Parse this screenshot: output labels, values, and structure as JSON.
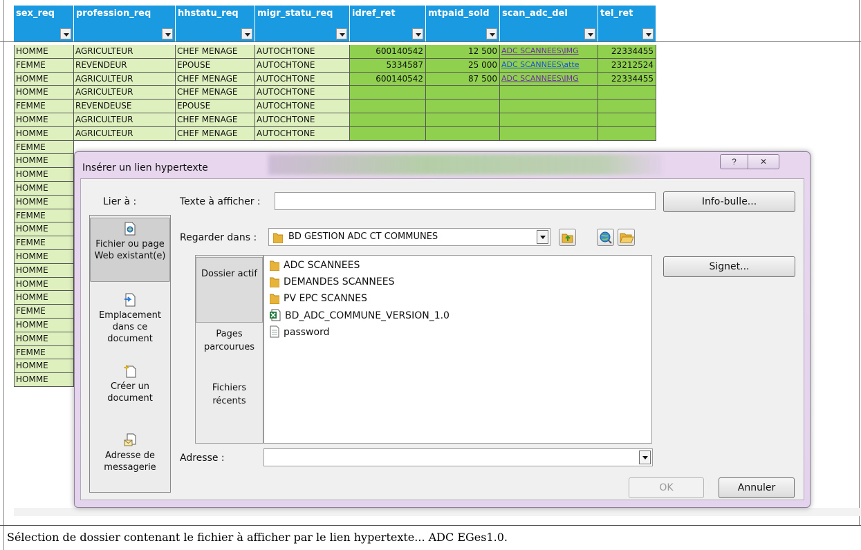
{
  "spreadsheet": {
    "headers": [
      "sex_req",
      "profession_req",
      "hhstatu_req",
      "migr_statu_req",
      "idref_ret",
      "mtpaid_sold",
      "scan_adc_del",
      "tel_ret"
    ],
    "rows": [
      [
        "HOMME",
        "AGRICULTEUR",
        "CHEF MENAGE",
        "AUTOCHTONE",
        "600140542",
        "12 500",
        "ADC SCANNEES\\IMG",
        "22334455"
      ],
      [
        "FEMME",
        "REVENDEUR",
        "EPOUSE",
        "AUTOCHTONE",
        "5334587",
        "25 000",
        "ADC SCANNEES\\atte",
        "23212524"
      ],
      [
        "HOMME",
        "AGRICULTEUR",
        "CHEF MENAGE",
        "AUTOCHTONE",
        "600140542",
        "87 500",
        "ADC SCANNEES\\IMG",
        "22334455"
      ],
      [
        "HOMME",
        "AGRICULTEUR",
        "CHEF MENAGE",
        "AUTOCHTONE",
        "",
        "",
        "",
        ""
      ],
      [
        "FEMME",
        "REVENDEUSE",
        "EPOUSE",
        "AUTOCHTONE",
        "",
        "",
        "",
        ""
      ],
      [
        "HOMME",
        "AGRICULTEUR",
        "CHEF MENAGE",
        "AUTOCHTONE",
        "",
        "",
        "",
        ""
      ],
      [
        "HOMME",
        "AGRICULTEUR",
        "CHEF MENAGE",
        "AUTOCHTONE",
        "",
        "",
        "",
        ""
      ]
    ],
    "sex_column_continued": [
      "FEMME",
      "HOMME",
      "HOMME",
      "HOMME",
      "HOMME",
      "FEMME",
      "HOMME",
      "FEMME",
      "HOMME",
      "HOMME",
      "HOMME",
      "HOMME",
      "FEMME",
      "HOMME",
      "HOMME",
      "FEMME",
      "HOMME",
      "HOMME"
    ],
    "colors": {
      "header": "#1a9ae0",
      "pale_cell": "#dff0bf",
      "green_cell": "#8fd14f"
    }
  },
  "dialog": {
    "title": "Insérer un lien hypertexte",
    "help_glyph": "?",
    "close_glyph": "✕",
    "link_to_label": "Lier à :",
    "link_to_items": [
      {
        "label": "Fichier ou page Web existant(e)",
        "icon": "existing-file-icon",
        "selected": true
      },
      {
        "label": "Emplacement dans ce document",
        "icon": "place-in-document-icon",
        "selected": false
      },
      {
        "label": "Créer un document",
        "icon": "new-document-icon",
        "selected": false
      },
      {
        "label": "Adresse de messagerie",
        "icon": "email-address-icon",
        "selected": false
      }
    ],
    "text_to_display_label": "Texte à afficher :",
    "text_to_display_value": "",
    "screentip_button": "Info-bulle...",
    "look_in_label": "Regarder dans :",
    "look_in_value": "BD GESTION ADC CT COMMUNES",
    "places": [
      {
        "label": "Dossier actif",
        "selected": true
      },
      {
        "label": "Pages parcourues",
        "selected": false
      },
      {
        "label": "Fichiers récents",
        "selected": false
      }
    ],
    "files": [
      {
        "name": "ADC SCANNEES",
        "icon": "folder-icon"
      },
      {
        "name": "DEMANDES SCANNEES",
        "icon": "folder-icon"
      },
      {
        "name": "PV EPC SCANNES",
        "icon": "folder-icon"
      },
      {
        "name": "BD_ADC_COMMUNE_VERSION_1.0",
        "icon": "excel-file-icon"
      },
      {
        "name": "password",
        "icon": "text-file-icon"
      }
    ],
    "bookmark_button": "Signet...",
    "address_label": "Adresse :",
    "address_value": "",
    "ok_button": "OK",
    "cancel_button": "Annuler"
  },
  "caption": "Sélection de dossier contenant le fichier à afficher par le lien hypertexte... ADC EGes1.0."
}
